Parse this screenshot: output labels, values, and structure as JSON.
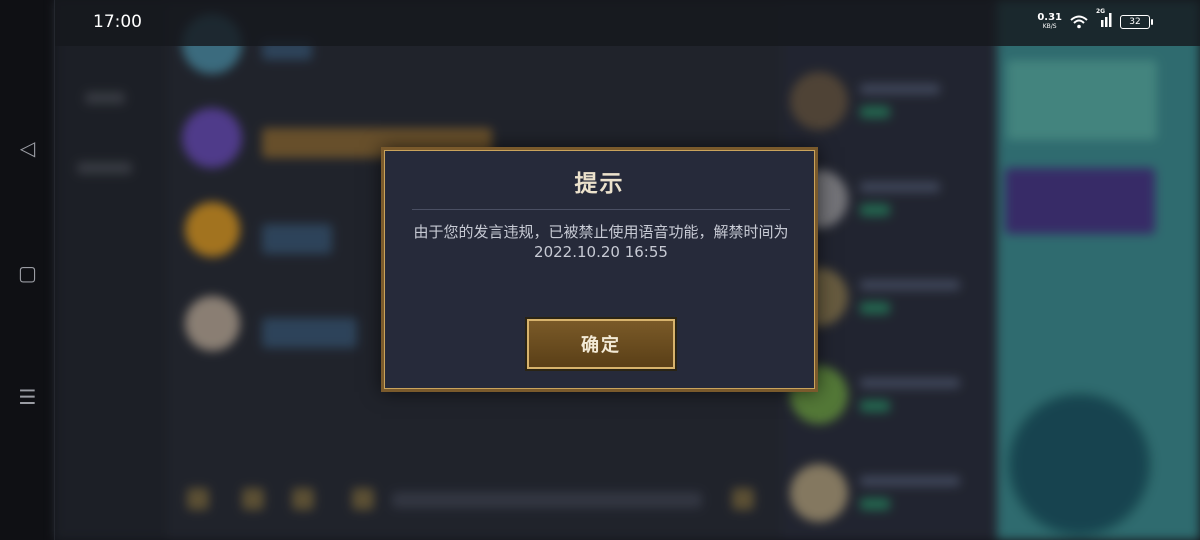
{
  "status_bar": {
    "time": "17:00",
    "net_speed_value": "0.31",
    "net_speed_unit": "KB/S",
    "signal_label": "2G",
    "battery_level": "32"
  },
  "nav_bar": {
    "back_glyph": "◁",
    "home_glyph": "▢",
    "menu_glyph": "☰"
  },
  "dialog": {
    "title": "提示",
    "message": "由于您的发言违规，已被禁止使用语音功能，解禁时间为2022.10.20 16:55",
    "confirm_label": "确定"
  },
  "colors": {
    "dialog_bg": "#262a3a",
    "dialog_border": "#c9a35c",
    "button_gold": "#7a5a28",
    "right_panel_teal": "#3f8f94"
  }
}
